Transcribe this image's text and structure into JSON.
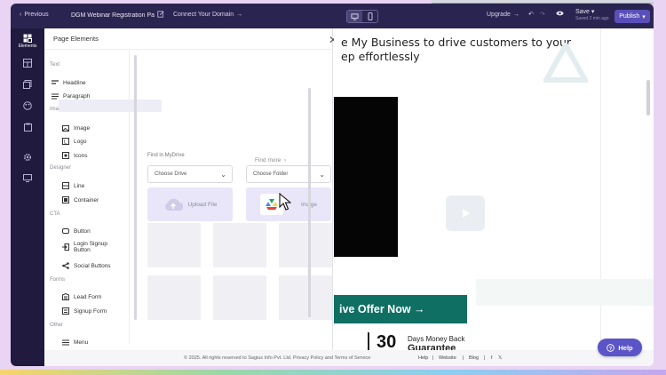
{
  "topbar": {
    "previous_label": "Previous",
    "page_title": "DGM Webinar Registration Page",
    "connect_label": "Connect Your Domain",
    "upgrade_label": "Upgrade",
    "save_label": "Save",
    "saved_status": "Saved 2 min ago",
    "publish_label": "Publish"
  },
  "rail": {
    "elements_label": "Elements"
  },
  "panel": {
    "title": "Page Elements",
    "sections": {
      "text": "Text",
      "images": "Images",
      "designer": "Designer",
      "cta": "CTA",
      "forms": "Forms",
      "other": "Other"
    },
    "items": {
      "headline": "Headline",
      "paragraph": "Paragraph",
      "image": "Image",
      "logo": "Logo",
      "icons": "Icons",
      "line": "Line",
      "container": "Container",
      "button": "Button",
      "login_signup_1": "Login Signup",
      "login_signup_2": "Button",
      "social_buttons": "Social Buttons",
      "lead_form": "Lead Form",
      "signup_form": "Signup Form",
      "menu": "Menu"
    },
    "find_more": "Find more",
    "find_in_mydrive": "Find in MyDrive",
    "choose_drive": "Choose Drive",
    "choose_folder": "Choose Folder",
    "upload_file": "Upload File",
    "add_image": "Image"
  },
  "canvas": {
    "hero_line1": "e My Business to drive customers to your",
    "hero_line2": "ep effortlessly",
    "cta_label": "ive Offer Now",
    "big_number": "30",
    "money_back_1": "Days Money Back",
    "money_back_2": "Guarantee"
  },
  "footer": {
    "copyright": "© 2025. All rights reserved to Sagius Info Pvt. Ltd.",
    "privacy": "Privacy Policy",
    "and": "and",
    "terms": "Terms of Service",
    "help": "Help",
    "website": "Website",
    "blog": "Blog"
  },
  "help_button": {
    "label": "Help"
  },
  "colors": {
    "topbar": "#2a2450",
    "rail": "#1f1a3e",
    "publish": "#5a4fb8",
    "cta": "#0f6f63",
    "help": "#5b53c8"
  }
}
